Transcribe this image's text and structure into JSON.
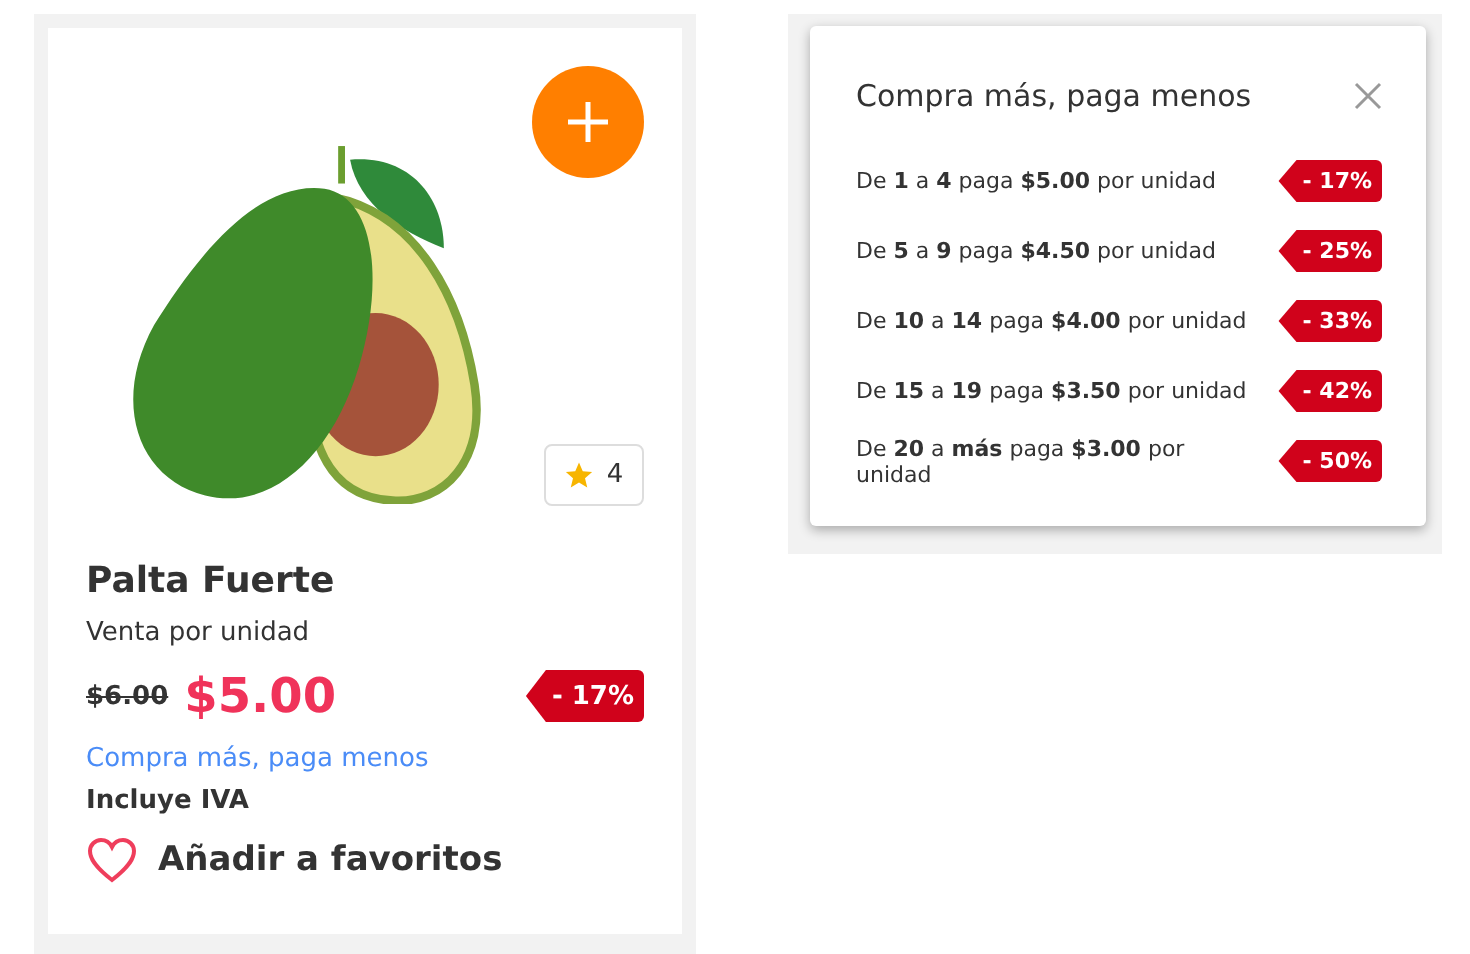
{
  "product": {
    "rating": "4",
    "name": "Palta Fuerte",
    "unit": "Venta por unidad",
    "old_price": "$6.00",
    "price": "$5.00",
    "discount": "- 17%",
    "promo_link": "Compra más, paga menos",
    "tax_note": "Incluye IVA",
    "favorite": "Añadir a favoritos"
  },
  "popup": {
    "title": "Compra más, paga menos",
    "tiers": [
      {
        "text": "De **1** a **4** paga **$5.00** por unidad",
        "discount": "- 17%"
      },
      {
        "text": "De **5** a **9** paga **$4.50** por unidad",
        "discount": "- 25%"
      },
      {
        "text": "De **10** a **14** paga **$4.00** por unidad",
        "discount": "- 33%"
      },
      {
        "text": "De **15** a **19** paga **$3.50** por unidad",
        "discount": "- 42%"
      },
      {
        "text": "De **20** a **más** paga **$3.00** por unidad",
        "discount": "- 50%"
      }
    ]
  }
}
